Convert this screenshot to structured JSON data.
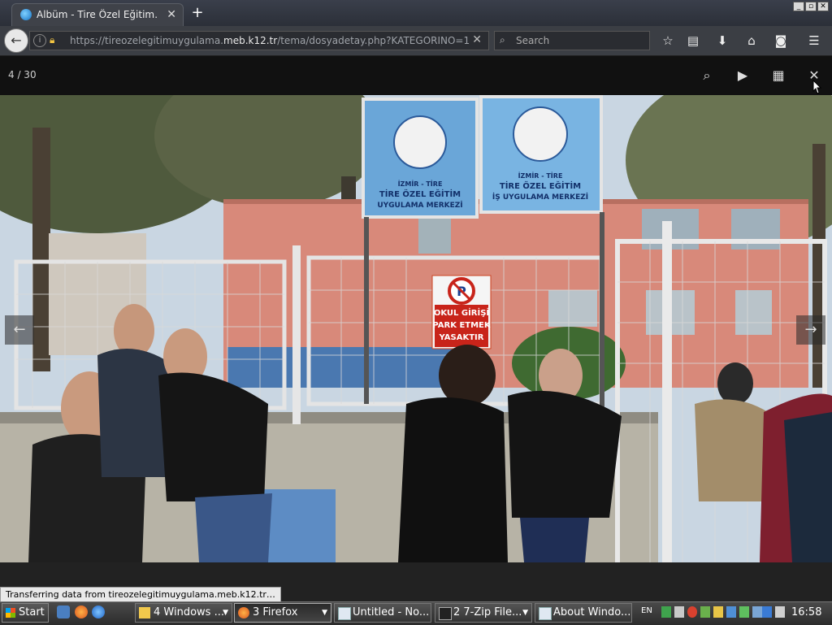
{
  "browser": {
    "tab_title": "Albüm - Tire Özel Eğitim…",
    "url_host_prefix": "https://tireozelegitimuygulama.",
    "url_host_domain": "meb.k12.tr",
    "url_path": "/tema/dosyadetay.php?KATEGORINO=1",
    "search_placeholder": "Search"
  },
  "gallery": {
    "counter": "4 / 30"
  },
  "photo": {
    "sign_left_line1": "İZMİR - TİRE",
    "sign_left_line2": "TİRE ÖZEL EĞİTİM",
    "sign_left_line3": "UYGULAMA MERKEZİ",
    "sign_right_line1": "İZMİR - TİRE",
    "sign_right_line2": "TİRE ÖZEL EĞİTİM",
    "sign_right_line3": "İŞ UYGULAMA MERKEZİ",
    "parking_line1": "OKUL GİRİŞİ",
    "parking_line2": "PARK ETMEK",
    "parking_line3": "YASAKTIR"
  },
  "status_text": "Transferring data from tireozelegitimuygulama.meb.k12.tr…",
  "taskbar": {
    "start_label": "Start",
    "tasks": [
      {
        "label": "4 Windows ..."
      },
      {
        "label": "3 Firefox"
      },
      {
        "label": "Untitled - No..."
      },
      {
        "label": "2 7-Zip File..."
      },
      {
        "label": "About Windo..."
      }
    ],
    "language": "EN",
    "clock": "16:58"
  },
  "icons": {
    "back": "back-arrow-icon",
    "lock": "lock-icon",
    "search": "search-icon",
    "bookmark": "star-icon",
    "reader": "reading-list-icon",
    "download": "download-icon",
    "home": "home-icon",
    "pocket": "pocket-icon",
    "menu": "hamburger-menu-icon",
    "zoom": "magnifier-icon",
    "play": "play-icon",
    "grid": "grid-icon",
    "close": "close-icon"
  }
}
